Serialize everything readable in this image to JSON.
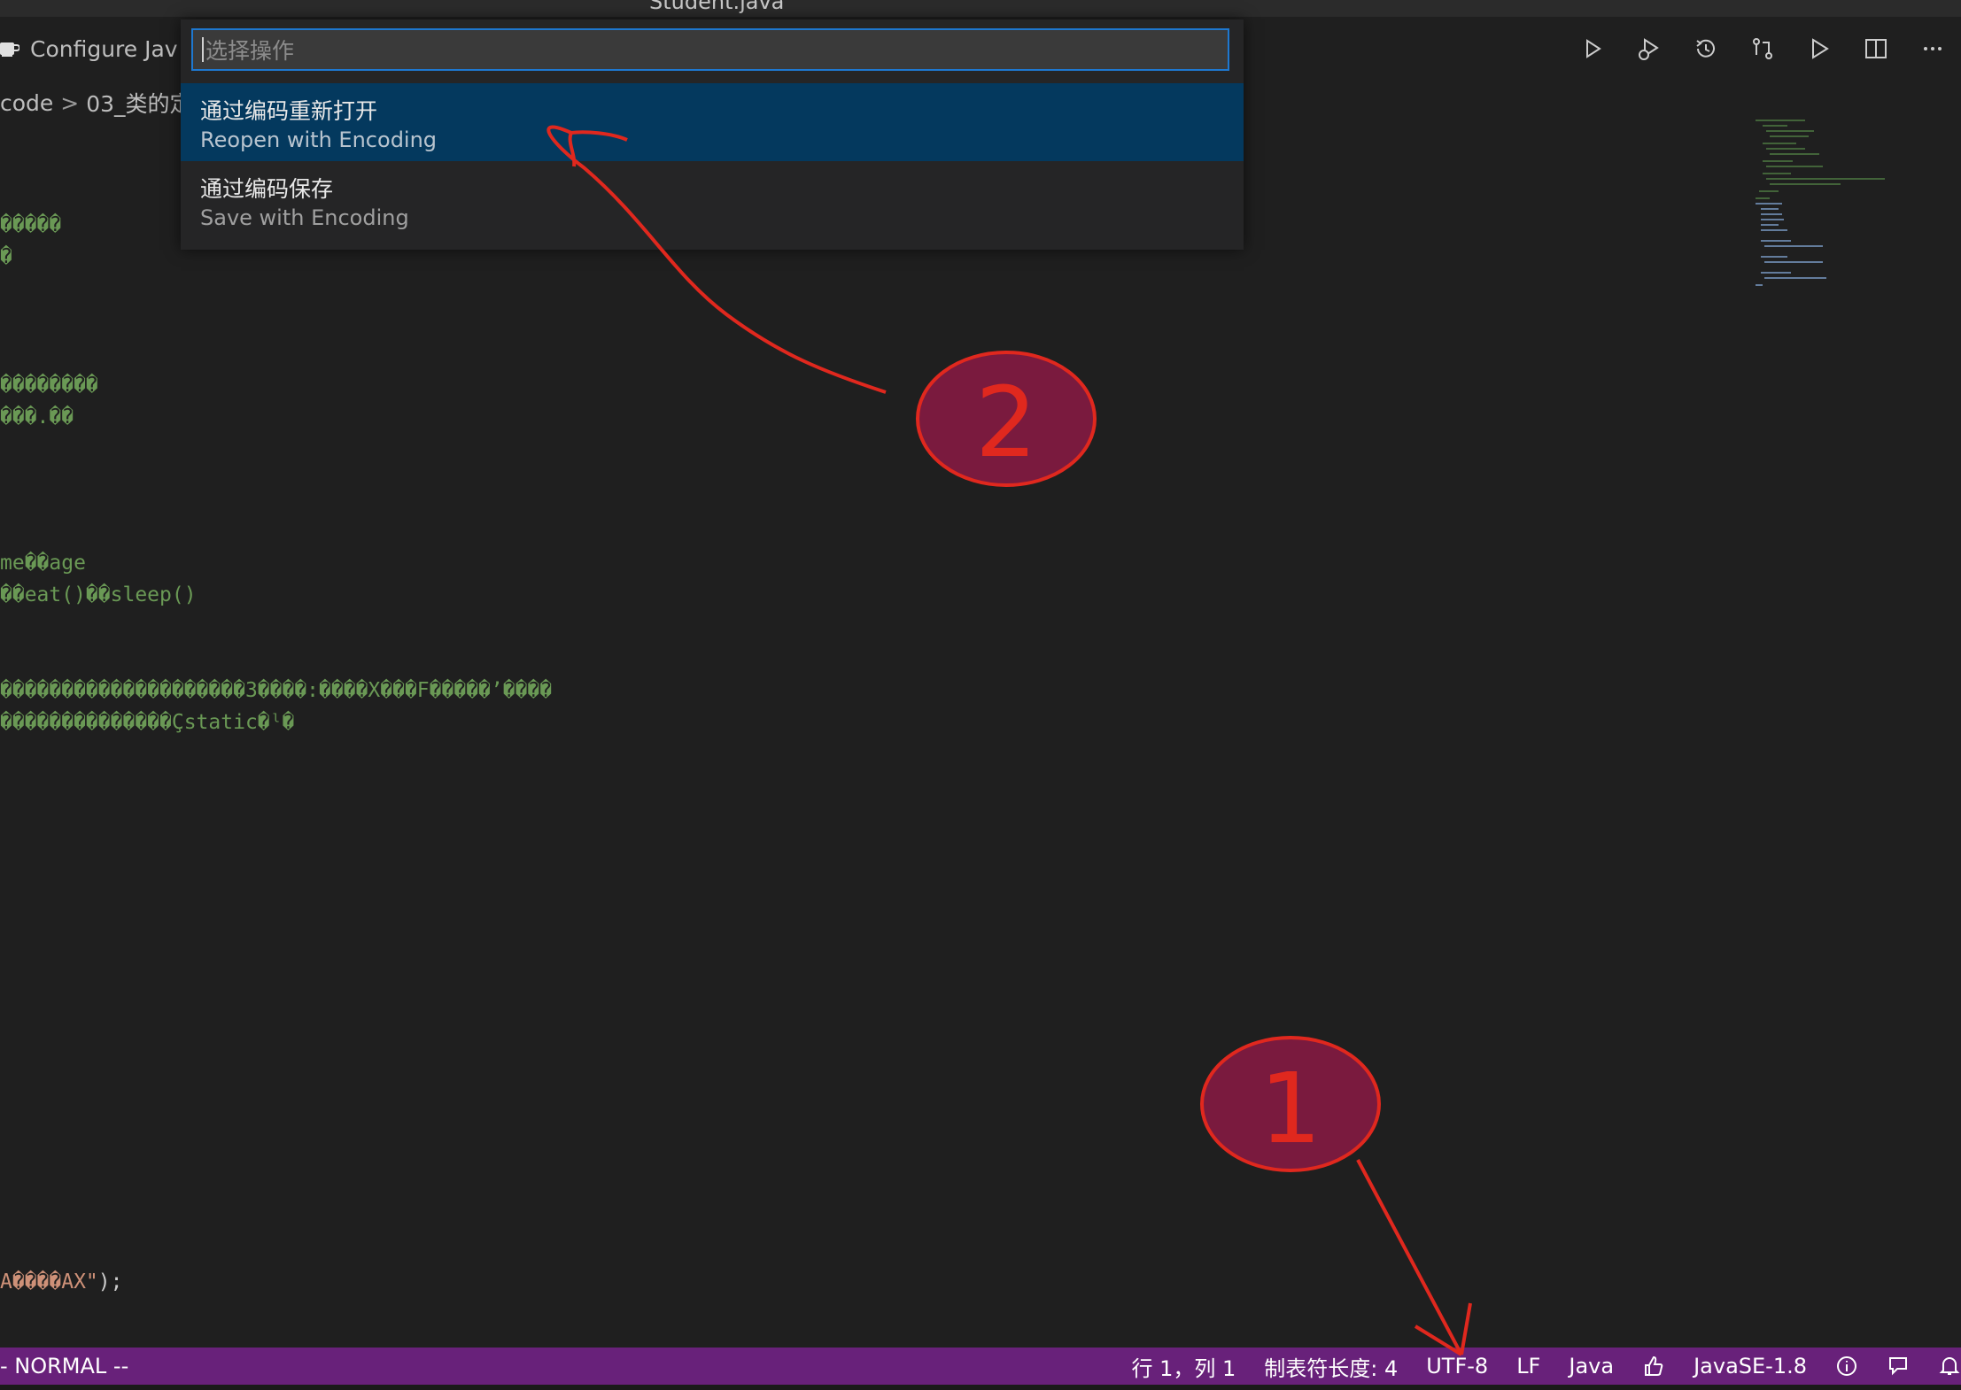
{
  "window": {
    "title": "Student.java"
  },
  "tab": {
    "label": "Configure Jav"
  },
  "breadcrumb": {
    "parts": [
      "code",
      "03_类的定"
    ]
  },
  "toolbar": {
    "buttons": [
      "run-icon",
      "debug-icon",
      "history-icon",
      "compare-icon",
      "run-all-icon",
      "split-editor-icon",
      "more-actions-icon"
    ]
  },
  "code_lines": [
    "�����",
    "�",
    "��������",
    "���.��",
    "me��age",
    "��eat()��sleep()",
    "��������������������3����:����X���F�����’����",
    "��������������Çstatic�ˡ�"
  ],
  "code_tail": {
    "text": "A����AX\"",
    "punct": ");"
  },
  "quick_pick": {
    "placeholder": "选择操作",
    "items": [
      {
        "label": "通过编码重新打开",
        "detail": "Reopen with Encoding",
        "selected": true
      },
      {
        "label": "通过编码保存",
        "detail": "Save with Encoding",
        "selected": false
      }
    ]
  },
  "status_bar": {
    "mode": "- NORMAL --",
    "position": "行 1，列 1",
    "tab_size": "制表符长度: 4",
    "encoding": "UTF-8",
    "eol": "LF",
    "language": "Java",
    "java_version": "JavaSE-1.8"
  },
  "annotations": [
    {
      "number": "1",
      "target": "encoding"
    },
    {
      "number": "2",
      "target": "Reopen with Encoding"
    }
  ],
  "colors": {
    "editor_bg": "#1f1f1f",
    "status_bar": "#68217a",
    "selection": "#04395e",
    "comment_green": "#6a9955",
    "annotation_red": "#e0281e",
    "annotation_fill": "#7a1a3e"
  }
}
